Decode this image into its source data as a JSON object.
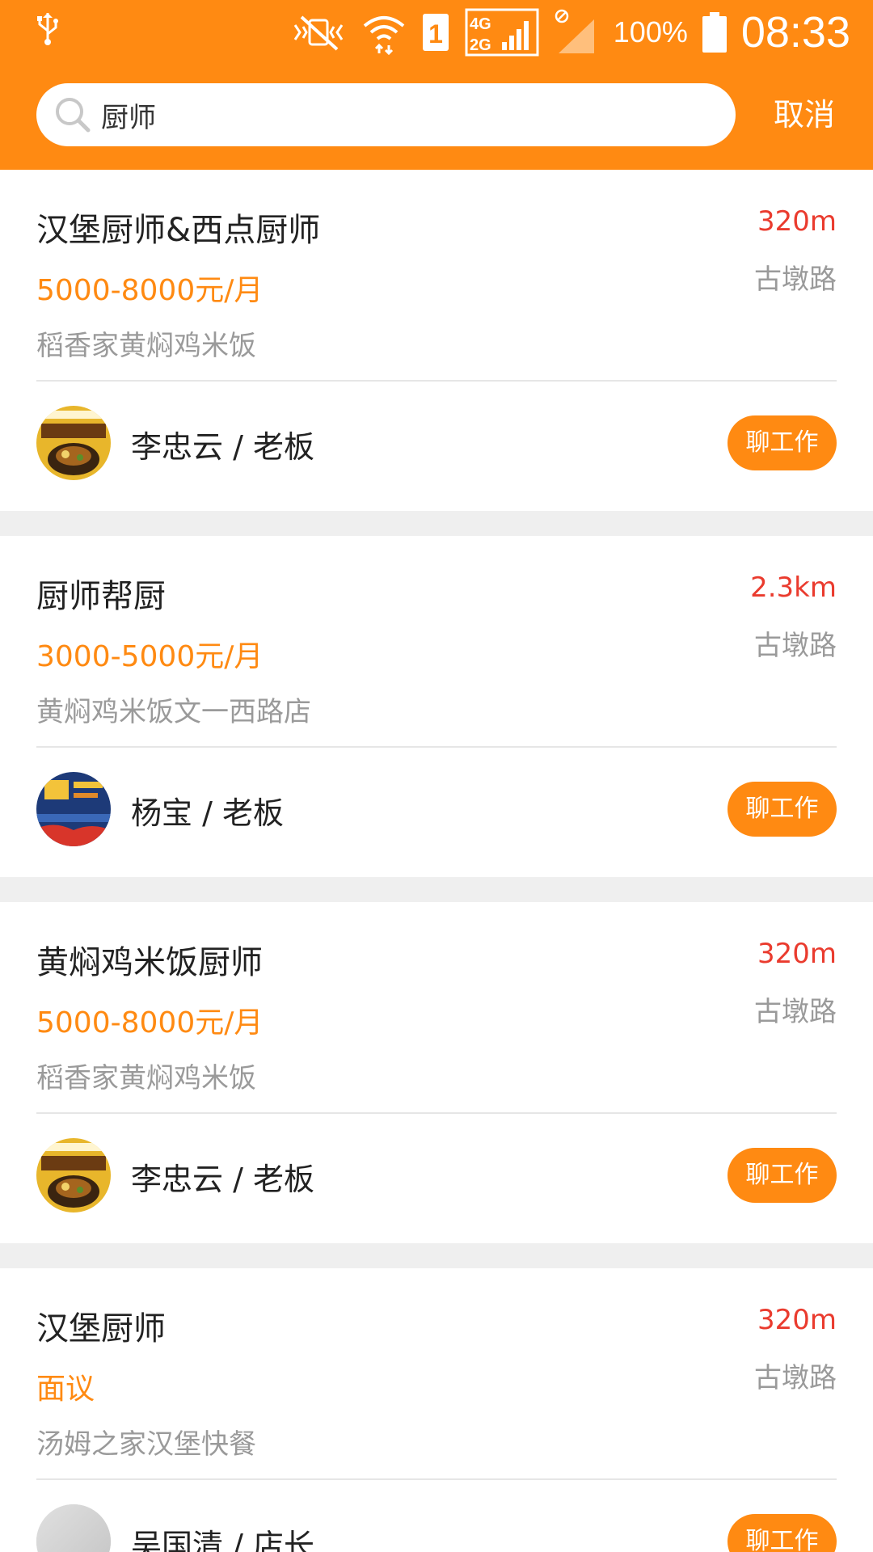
{
  "status_bar": {
    "usb_icon": "usb-icon",
    "battery_percent": "100%",
    "time": "08:33",
    "network_type": "4G 2G",
    "sim_slot": "1"
  },
  "search": {
    "query": "厨师",
    "cancel_label": "取消"
  },
  "colors": {
    "accent": "#ff8a12",
    "distance": "#ea3b2e",
    "secondary_text": "#9a9a9a"
  },
  "jobs": [
    {
      "title": "汉堡厨师&西点厨师",
      "salary": "5000-8000元/月",
      "company": "稻香家黄焖鸡米饭",
      "distance": "320m",
      "location": "古墩路",
      "contact": "李忠云 / 老板",
      "chat_label": "聊工作",
      "avatar": "yellow-braised-chicken-logo"
    },
    {
      "title": "厨师帮厨",
      "salary": "3000-5000元/月",
      "company": "黄焖鸡米饭文一西路店",
      "distance": "2.3km",
      "location": "古墩路",
      "contact": "杨宝 / 老板",
      "chat_label": "聊工作",
      "avatar": "anniversary-poster"
    },
    {
      "title": "黄焖鸡米饭厨师",
      "salary": "5000-8000元/月",
      "company": "稻香家黄焖鸡米饭",
      "distance": "320m",
      "location": "古墩路",
      "contact": "李忠云 / 老板",
      "chat_label": "聊工作",
      "avatar": "yellow-braised-chicken-logo"
    },
    {
      "title": "汉堡厨师",
      "salary": "面议",
      "company": "汤姆之家汉堡快餐",
      "distance": "320m",
      "location": "古墩路",
      "contact": "吴国清 / 店长",
      "chat_label": "聊工作",
      "avatar": "gray-placeholder"
    }
  ]
}
